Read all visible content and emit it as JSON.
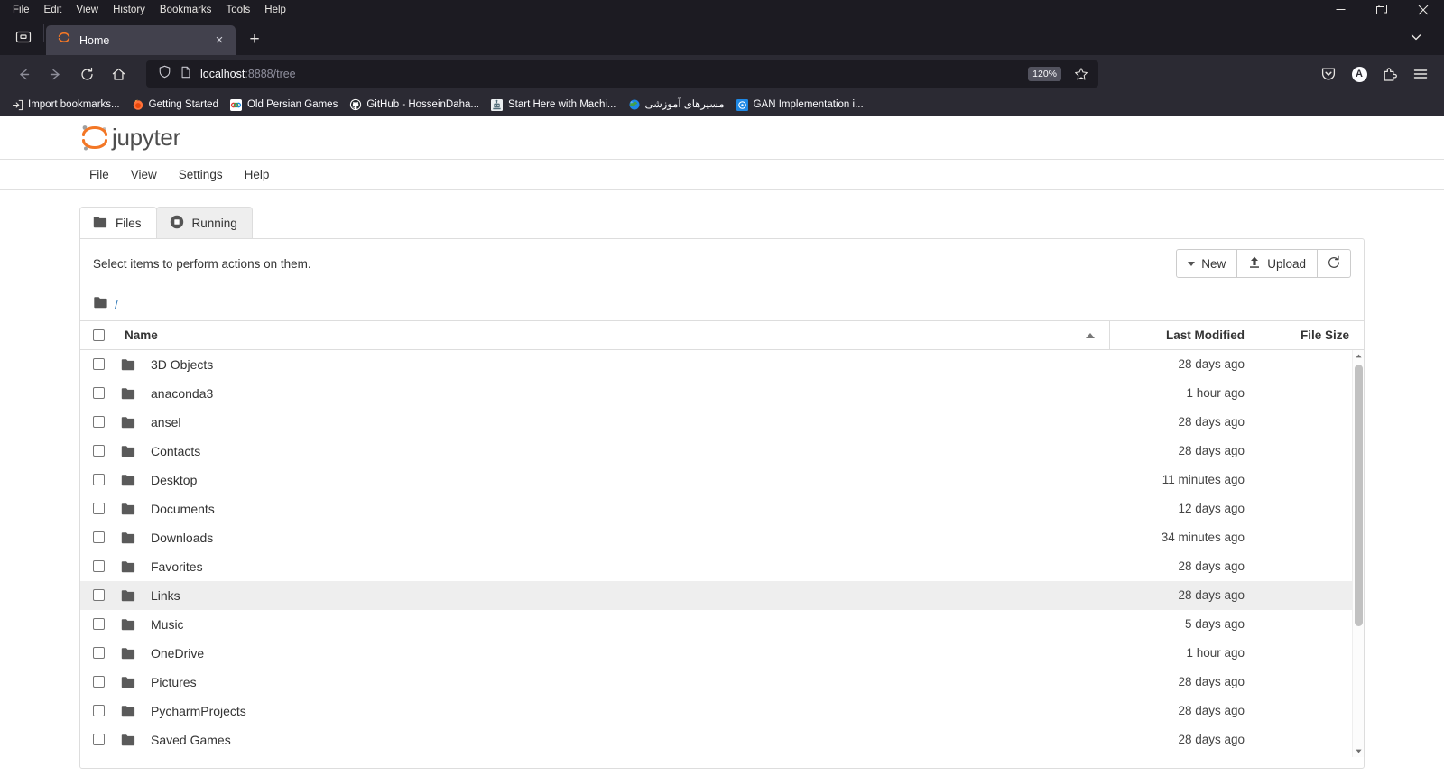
{
  "browser": {
    "menus": [
      {
        "label": "File",
        "accel": "F"
      },
      {
        "label": "Edit",
        "accel": "E"
      },
      {
        "label": "View",
        "accel": "V"
      },
      {
        "label": "History",
        "accel": "s"
      },
      {
        "label": "Bookmarks",
        "accel": "B"
      },
      {
        "label": "Tools",
        "accel": "T"
      },
      {
        "label": "Help",
        "accel": "H"
      }
    ],
    "window_controls": {
      "minimize": "minimize-icon",
      "restore": "restore-icon",
      "close": "close-icon"
    },
    "tab": {
      "title": "Home",
      "favicon": "jupyter-favicon",
      "close_label": "×"
    },
    "new_tab_label": "+",
    "list_all_tabs": "chevron-down-icon",
    "nav": {
      "back": "back-arrow-icon",
      "forward": "forward-arrow-icon",
      "reload": "reload-icon",
      "home": "home-icon"
    },
    "url": {
      "host": "localhost",
      "path": ":8888/tree",
      "shield": "shield-icon",
      "page_icon": "page-icon",
      "zoom_level": "120%",
      "bookmark_star": "star-icon"
    },
    "toolbar_right": {
      "pocket": "pocket-icon",
      "account": "A",
      "extensions": "extensions-icon",
      "app_menu": "hamburger-menu-icon"
    },
    "bookmarks": [
      {
        "label": "Import bookmarks...",
        "icon": "import-icon"
      },
      {
        "label": "Getting Started",
        "icon": "firefox-icon"
      },
      {
        "label": "Old Persian Games",
        "icon": "games-icon"
      },
      {
        "label": "GitHub - HosseinDaha...",
        "icon": "github-icon"
      },
      {
        "label": "Start Here with Machi...",
        "icon": "robot-icon"
      },
      {
        "label": "مسیرهای آموزشی",
        "icon": "earth-icon"
      },
      {
        "label": "GAN Implementation i...",
        "icon": "medium-icon"
      }
    ]
  },
  "jupyter": {
    "brand": "jupyter",
    "menu": [
      "File",
      "View",
      "Settings",
      "Help"
    ],
    "tabs": [
      {
        "label": "Files",
        "icon": "folder-icon",
        "active": true
      },
      {
        "label": "Running",
        "icon": "stop-circle-icon",
        "active": false
      }
    ],
    "toolbar": {
      "hint": "Select items to perform actions on them.",
      "new_label": "New",
      "upload_label": "Upload",
      "refresh_icon": "refresh-icon"
    },
    "breadcrumb": {
      "icon": "folder-icon",
      "root": "/"
    },
    "table": {
      "headers": {
        "name": "Name",
        "last_modified": "Last Modified",
        "file_size": "File Size"
      },
      "sort": "ascending",
      "rows": [
        {
          "name": "3D Objects",
          "modified": "28 days ago",
          "size": "",
          "hover": false
        },
        {
          "name": "anaconda3",
          "modified": "1 hour ago",
          "size": "",
          "hover": false
        },
        {
          "name": "ansel",
          "modified": "28 days ago",
          "size": "",
          "hover": false
        },
        {
          "name": "Contacts",
          "modified": "28 days ago",
          "size": "",
          "hover": false
        },
        {
          "name": "Desktop",
          "modified": "11 minutes ago",
          "size": "",
          "hover": false
        },
        {
          "name": "Documents",
          "modified": "12 days ago",
          "size": "",
          "hover": false
        },
        {
          "name": "Downloads",
          "modified": "34 minutes ago",
          "size": "",
          "hover": false
        },
        {
          "name": "Favorites",
          "modified": "28 days ago",
          "size": "",
          "hover": false
        },
        {
          "name": "Links",
          "modified": "28 days ago",
          "size": "",
          "hover": true
        },
        {
          "name": "Music",
          "modified": "5 days ago",
          "size": "",
          "hover": false
        },
        {
          "name": "OneDrive",
          "modified": "1 hour ago",
          "size": "",
          "hover": false
        },
        {
          "name": "Pictures",
          "modified": "28 days ago",
          "size": "",
          "hover": false
        },
        {
          "name": "PycharmProjects",
          "modified": "28 days ago",
          "size": "",
          "hover": false
        },
        {
          "name": "Saved Games",
          "modified": "28 days ago",
          "size": "",
          "hover": false
        }
      ]
    }
  },
  "colors": {
    "chrome_dark": "#1c1b22",
    "chrome_toolbar": "#2b2a33",
    "tab_active": "#42414d",
    "jupyter_orange": "#f37726",
    "link_blue": "#337ab7",
    "row_hover": "#eeeeee"
  }
}
